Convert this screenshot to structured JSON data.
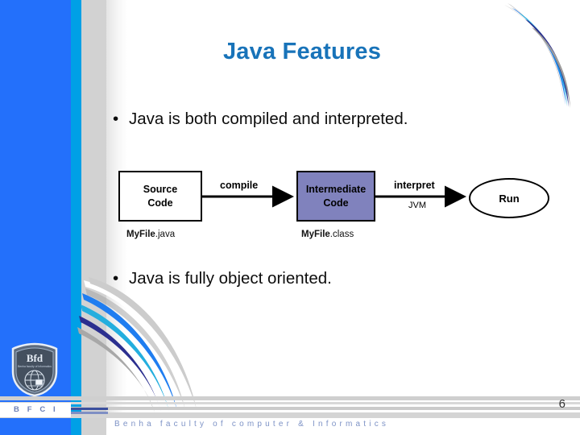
{
  "slide": {
    "title": "Java Features",
    "page_number": "6",
    "bullets": [
      {
        "marker": "•",
        "text": "Java is both compiled and interpreted."
      },
      {
        "marker": "•",
        "text": "Java is fully object oriented."
      }
    ]
  },
  "diagram": {
    "nodes": [
      {
        "id": "source",
        "line1": "Source",
        "line2": "Code",
        "file_bold": "MyFile",
        "file_rest": ".java",
        "fill": "#ffffff"
      },
      {
        "id": "intermediate",
        "line1": "Intermediate",
        "line2": "Code",
        "file_bold": "MyFile",
        "file_rest": ".class",
        "fill": "#8082bd"
      },
      {
        "id": "run",
        "line1": "Run",
        "fill": "#ffffff"
      }
    ],
    "edges": [
      {
        "id": "compile",
        "label": "compile",
        "sublabel": ""
      },
      {
        "id": "interpret",
        "label": "interpret",
        "sublabel": "JVM"
      }
    ]
  },
  "branding": {
    "badge_text": "B F C I",
    "footer_text": "Benha faculty of computer & Informatics",
    "logo_name": "bfci-shield-globe-logo"
  },
  "theme": {
    "title_color": "#1873b9",
    "band_blue": "#2370fb",
    "band_cyan": "#00a0e6",
    "band_gray": "#d2d2d2",
    "node_accent": "#8082bd",
    "footer_text_color": "#7e93c6"
  }
}
